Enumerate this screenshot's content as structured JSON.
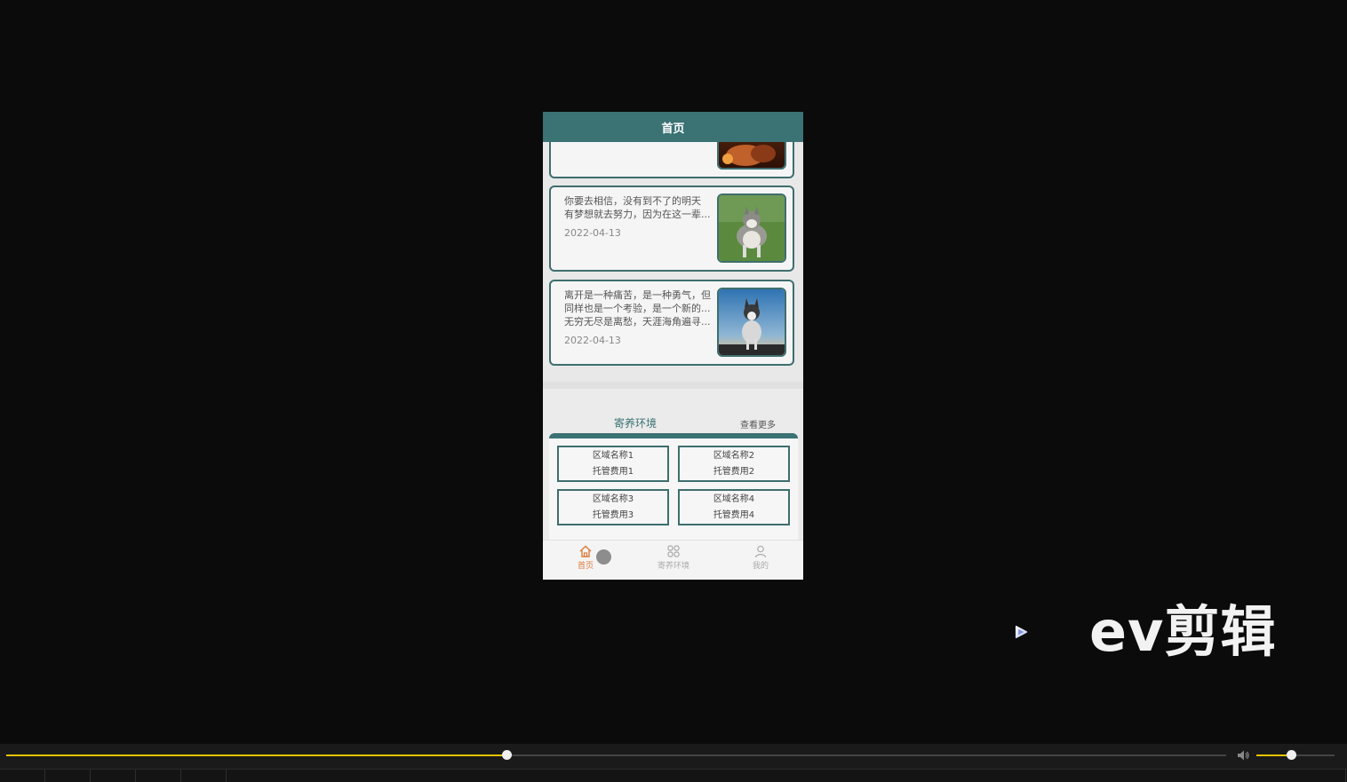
{
  "header": {
    "title": "首页"
  },
  "news": [
    {
      "lines": [],
      "date": "",
      "image": "dog-fire-photo"
    },
    {
      "lines": [
        "你要去相信，没有到不了的明天",
        "有梦想就去努力，因为在这一辈..."
      ],
      "date": "2022-04-13",
      "image": "husky-grass-photo"
    },
    {
      "lines": [
        "离开是一种痛苦，是一种勇气，但",
        "同样也是一个考验，是一个新的...",
        "无穷无尽是离愁，天涯海角遍寻..."
      ],
      "date": "2022-04-13",
      "image": "husky-sunset-photo"
    }
  ],
  "environment": {
    "title": "寄养环境",
    "more_label": "查看更多",
    "areas": [
      {
        "name": "区域名称1",
        "fee": "托管费用1"
      },
      {
        "name": "区域名称2",
        "fee": "托管费用2"
      },
      {
        "name": "区域名称3",
        "fee": "托管费用3"
      },
      {
        "name": "区域名称4",
        "fee": "托管费用4"
      }
    ]
  },
  "tabbar": {
    "items": [
      {
        "label": "首页",
        "icon": "home-icon",
        "active": true
      },
      {
        "label": "寄养环境",
        "icon": "grid-icon",
        "active": false
      },
      {
        "label": "我的",
        "icon": "user-icon",
        "active": false
      }
    ]
  },
  "watermark": {
    "text": "ev剪辑"
  },
  "player": {
    "progress": 0.41,
    "volume": 0.44,
    "accent": "#e8c400"
  },
  "colors": {
    "brand": "#3b7274",
    "tab_active": "#e07a3a"
  }
}
